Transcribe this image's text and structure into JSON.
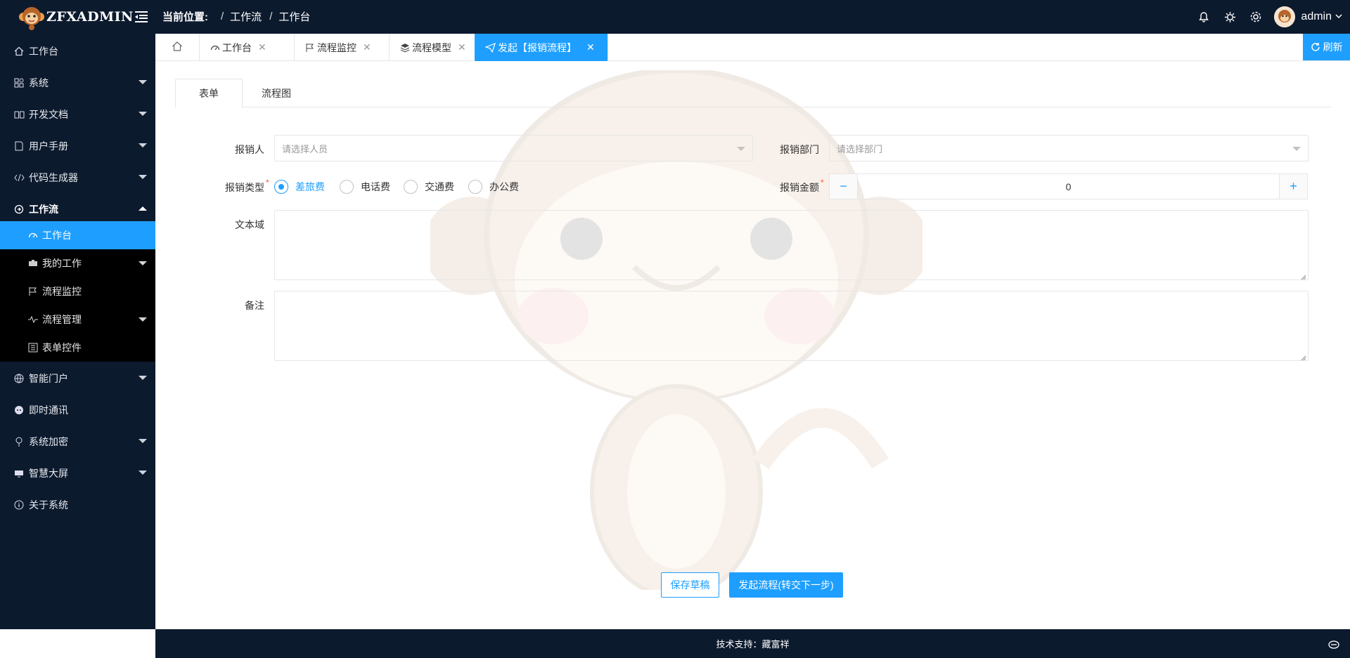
{
  "header": {
    "logo_text": "ZFXADMIN",
    "breadcrumb_title": "当前位置:",
    "breadcrumb": [
      "工作流",
      "工作台"
    ],
    "user_name": "admin"
  },
  "sidebar": {
    "items": [
      {
        "label": "工作台",
        "icon": "home-icon"
      },
      {
        "label": "系统",
        "icon": "apps-icon"
      },
      {
        "label": "开发文档",
        "icon": "book-icon"
      },
      {
        "label": "用户手册",
        "icon": "note-icon"
      },
      {
        "label": "代码生成器",
        "icon": "code-icon"
      },
      {
        "label": "工作流",
        "icon": "workflow-icon"
      },
      {
        "label": "智能门户",
        "icon": "globe-icon"
      },
      {
        "label": "即时通讯",
        "icon": "chat-icon"
      },
      {
        "label": "系统加密",
        "icon": "key-icon"
      },
      {
        "label": "智慧大屏",
        "icon": "screen-icon"
      },
      {
        "label": "关于系统",
        "icon": "info-icon"
      }
    ],
    "workflow_sub": [
      {
        "label": "工作台",
        "icon": "dashboard-icon"
      },
      {
        "label": "我的工作",
        "icon": "briefcase-icon"
      },
      {
        "label": "流程监控",
        "icon": "flag-icon"
      },
      {
        "label": "流程管理",
        "icon": "pulse-icon"
      },
      {
        "label": "表单控件",
        "icon": "form-icon"
      }
    ]
  },
  "tabs": [
    {
      "label": "工作台",
      "icon": "dashboard-icon"
    },
    {
      "label": "流程监控",
      "icon": "flag-icon"
    },
    {
      "label": "流程模型",
      "icon": "layers-icon"
    },
    {
      "label": "发起【报销流程】",
      "icon": "send-icon"
    }
  ],
  "refresh_label": "刷新",
  "content_tabs": [
    "表单",
    "流程图"
  ],
  "form": {
    "applicant_label": "报销人",
    "applicant_placeholder": "请选择人员",
    "department_label": "报销部门",
    "department_placeholder": "请选择部门",
    "type_label": "报销类型",
    "type_options": [
      "差旅费",
      "电话费",
      "交通费",
      "办公费"
    ],
    "type_selected": "差旅费",
    "amount_label": "报销金额",
    "amount_value": "0",
    "textarea_label": "文本域",
    "remark_label": "备注",
    "required_mark": "*",
    "minus_symbol": "−",
    "plus_symbol": "+",
    "save_draft_label": "保存草稿",
    "submit_label": "发起流程(转交下一步)"
  },
  "footer": {
    "text": "技术支持：藏富祥"
  },
  "colors": {
    "sidebar_bg": "#0c1a2e",
    "accent": "#1e9fff",
    "required": "#ff5722"
  }
}
